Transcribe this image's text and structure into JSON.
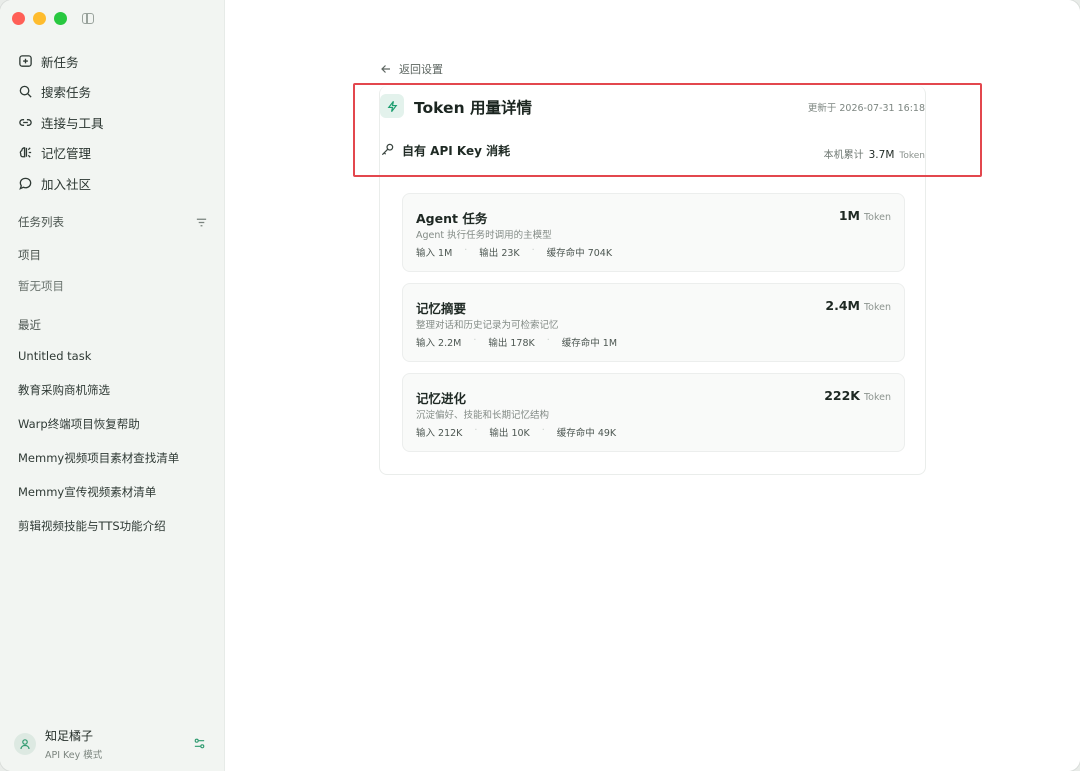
{
  "sidebar": {
    "nav": [
      {
        "label": "新任务",
        "icon": "new-task-icon"
      },
      {
        "label": "搜索任务",
        "icon": "search-icon"
      },
      {
        "label": "连接与工具",
        "icon": "link-icon"
      },
      {
        "label": "记忆管理",
        "icon": "memory-icon"
      },
      {
        "label": "加入社区",
        "icon": "chat-bubble-icon"
      }
    ],
    "task_list_label": "任务列表",
    "projects_label": "项目",
    "no_projects": "暂无项目",
    "recent_label": "最近",
    "recent": [
      "Untitled task",
      "教育采购商机筛选",
      "Warp终端项目恢复帮助",
      "Memmy视频项目素材查找清单",
      "Memmy宣传视频素材清单",
      "剪辑视频技能与TTS功能介绍"
    ],
    "user": {
      "name": "知足橘子",
      "mode": "API Key 模式"
    }
  },
  "main": {
    "back_label": "返回设置",
    "title": "Token 用量详情",
    "updated": "更新于 2026-07-31 16:18",
    "subtitle": "自有 API Key 消耗",
    "total_label": "本机累计",
    "total_value": "3.7M",
    "total_unit": "Token",
    "cards": [
      {
        "title": "Agent 任务",
        "value": "1M",
        "unit": "Token",
        "desc": "Agent 执行任务时调用的主模型",
        "input": "输入 1M",
        "output": "输出 23K",
        "cache": "缓存命中 704K"
      },
      {
        "title": "记忆摘要",
        "value": "2.4M",
        "unit": "Token",
        "desc": "整理对话和历史记录为可检索记忆",
        "input": "输入 2.2M",
        "output": "输出 178K",
        "cache": "缓存命中 1M"
      },
      {
        "title": "记忆进化",
        "value": "222K",
        "unit": "Token",
        "desc": "沉淀偏好、技能和长期记忆结构",
        "input": "输入 212K",
        "output": "输出 10K",
        "cache": "缓存命中 49K"
      }
    ]
  },
  "colors": {
    "accent": "#1e9e70",
    "highlight": "#e3474e",
    "sidebar_bg": "#f2f5f2"
  }
}
